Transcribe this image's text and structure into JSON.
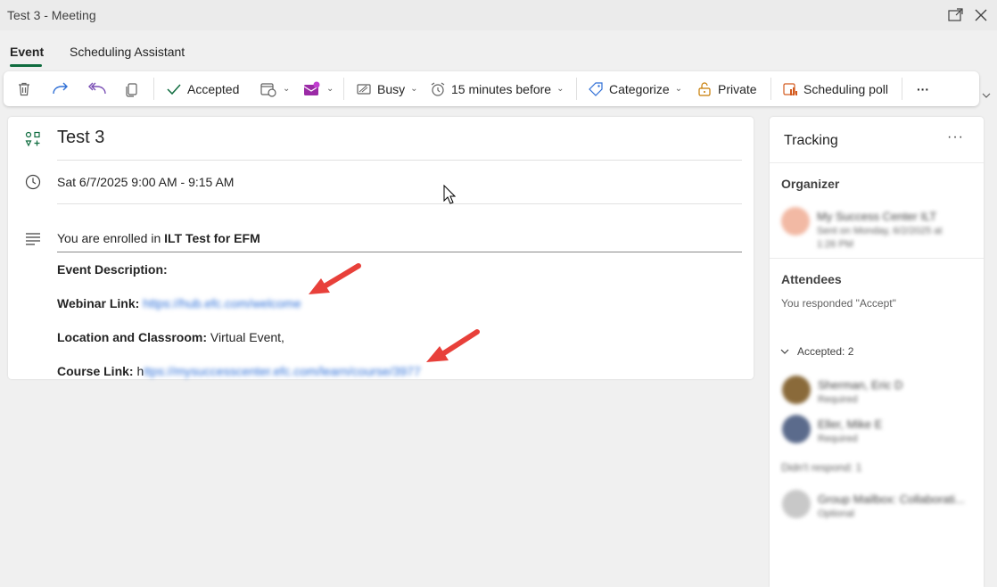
{
  "window": {
    "title": "Test 3 - Meeting"
  },
  "tabs": [
    {
      "label": "Event"
    },
    {
      "label": "Scheduling Assistant"
    }
  ],
  "toolbar": {
    "delete": "delete-icon",
    "forward": "forward-icon",
    "reply_all": "reply-all-icon",
    "copy": "copy-icon",
    "response_label": "Accepted",
    "show_as_label": "Busy",
    "reminder_label": "15 minutes before",
    "categorize_label": "Categorize",
    "private_label": "Private",
    "poll_label": "Scheduling poll",
    "more_label": "···"
  },
  "event": {
    "title": "Test 3",
    "datetime": "Sat 6/7/2025 9:00 AM - 9:15 AM",
    "enrolled_prefix": "You are enrolled in ",
    "course_name": "ILT Test for EFM",
    "description_label": "Event Description:",
    "webinar_label": "Webinar Link: ",
    "webinar_value": "https://hub.efc.com/welcome",
    "location_label": "Location and Classroom: ",
    "location_value": "Virtual Event,",
    "course_link_label": "Course Link: ",
    "course_link_first": "h",
    "course_link_value": "ttps://mysuccesscenter.efc.com/learn/course/3977"
  },
  "tracking": {
    "title": "Tracking",
    "more_label": "···",
    "organizer_heading": "Organizer",
    "organizer_name": "My Success Center ILT",
    "organizer_sub_1": "Sent on Monday, 6/2/2025 at",
    "organizer_sub_2": "1:26 PM",
    "attendees_heading": "Attendees",
    "response_text": "You responded \"Accept\"",
    "accepted_label": "Accepted: 2",
    "attendees": [
      {
        "name": "Sherman, Eric D",
        "status": "Required"
      },
      {
        "name": "Eller, Mike E",
        "status": "Required"
      }
    ],
    "not_responded_label": "Didn't respond: 1",
    "pending": {
      "name": "Group Mailbox: Collaborati...",
      "status": "Optional"
    }
  },
  "colors": {
    "accent": "#0f6c3f",
    "annotation_arrow": "#e8403a",
    "link_blur": "#2b6ed8"
  }
}
